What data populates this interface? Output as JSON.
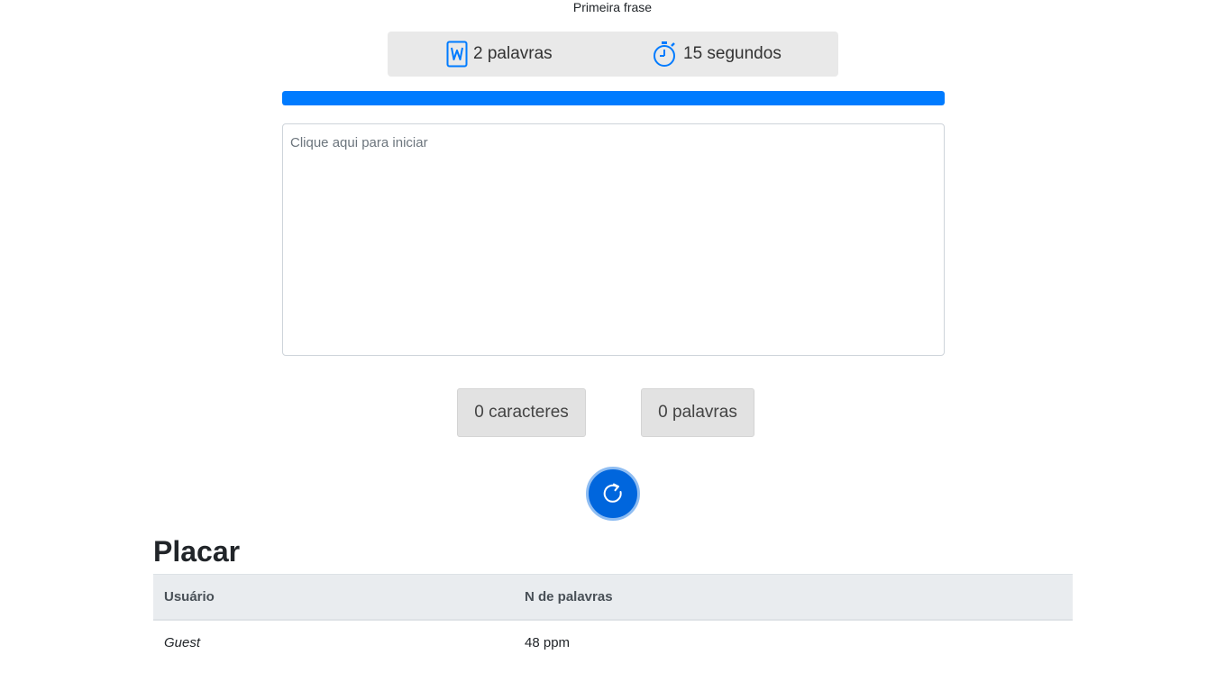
{
  "phrase": "Primeira frase",
  "stats": {
    "words_icon": "word-document-icon",
    "words_label": "2 palavras",
    "time_icon": "stopwatch-icon",
    "time_label": "15 segundos"
  },
  "progress": {
    "percent": 100,
    "color": "#007bff"
  },
  "typing_area": {
    "placeholder": "Clique aqui para iniciar",
    "value": ""
  },
  "counters": {
    "characters": "0 caracteres",
    "words": "0 palavras"
  },
  "restart_button": {
    "icon": "restart-icon",
    "color": "#0066dd"
  },
  "scoreboard": {
    "title": "Placar",
    "columns": [
      "Usuário",
      "N de palavras"
    ],
    "rows": [
      {
        "user": "Guest",
        "score": "48 ppm"
      }
    ]
  }
}
